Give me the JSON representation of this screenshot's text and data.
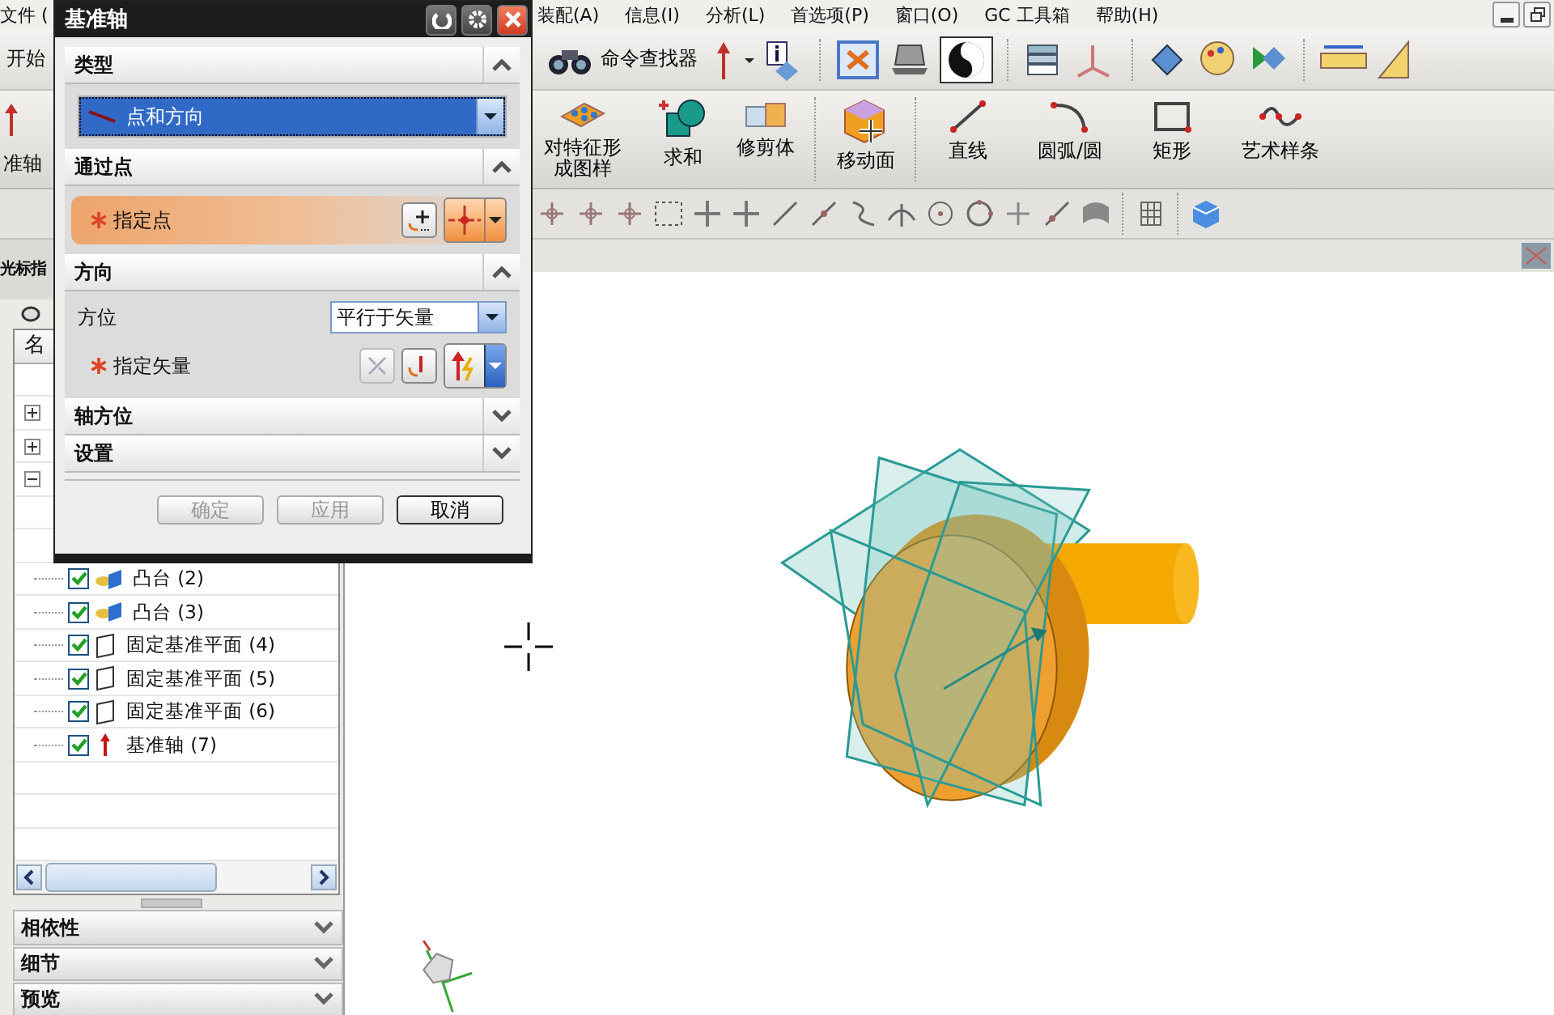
{
  "menu_bar": {
    "left_item": "文件 (",
    "items": [
      "装配(A)",
      "信息(I)",
      "分析(L)",
      "首选项(P)",
      "窗口(O)",
      "GC 工具箱",
      "帮助(H)"
    ]
  },
  "standard_toolbar": {
    "start": "开始",
    "command_finder": "命令查找器"
  },
  "feature_toolbar": {
    "left_label": "准轴",
    "items": [
      {
        "label": "对特征形成图样",
        "kind": "pattern"
      },
      {
        "label": "求和",
        "kind": "unite"
      },
      {
        "label": "修剪体",
        "kind": "trim"
      }
    ],
    "move_face": "移动面",
    "sketch_items": [
      {
        "label": "直线",
        "kind": "line"
      },
      {
        "label": "圆弧/圆",
        "kind": "arc"
      },
      {
        "label": "矩形",
        "kind": "rect"
      },
      {
        "label": "艺术样条",
        "kind": "spline"
      }
    ]
  },
  "navigator": {
    "tab": "光标指",
    "column": "名",
    "toggles": [
      {
        "expanded": false
      },
      {
        "expanded": false
      },
      {
        "expanded": true
      }
    ],
    "items": [
      {
        "label": "凸台 (2)",
        "kind": "boss",
        "checked": true
      },
      {
        "label": "凸台 (3)",
        "kind": "boss",
        "checked": true
      },
      {
        "label": "固定基准平面 (4)",
        "kind": "plane",
        "checked": true
      },
      {
        "label": "固定基准平面 (5)",
        "kind": "plane",
        "checked": true
      },
      {
        "label": "固定基准平面 (6)",
        "kind": "plane",
        "checked": true
      },
      {
        "label": "基准轴 (7)",
        "kind": "axis",
        "checked": true
      }
    ],
    "panels": [
      {
        "label": "相依性",
        "expanded": false
      },
      {
        "label": "细节",
        "expanded": false
      },
      {
        "label": "预览",
        "expanded": false
      }
    ]
  },
  "dialog": {
    "title": "基准轴",
    "sections": [
      {
        "title": "类型",
        "expanded": true,
        "rows": [
          {
            "kind": "select",
            "value": "点和方向"
          }
        ]
      },
      {
        "title": "通过点",
        "expanded": true,
        "rows": [
          {
            "kind": "point",
            "label": "指定点",
            "required": true
          }
        ]
      },
      {
        "title": "方向",
        "expanded": true,
        "rows": [
          {
            "kind": "option",
            "label": "方位",
            "value": "平行于矢量"
          },
          {
            "kind": "vector",
            "label": "指定矢量",
            "required": true
          }
        ]
      },
      {
        "title": "轴方位",
        "expanded": false
      },
      {
        "title": "设置",
        "expanded": false
      }
    ],
    "buttons": [
      {
        "label": "确定",
        "disabled": true
      },
      {
        "label": "应用",
        "disabled": true
      },
      {
        "label": "取消",
        "disabled": false
      }
    ]
  }
}
